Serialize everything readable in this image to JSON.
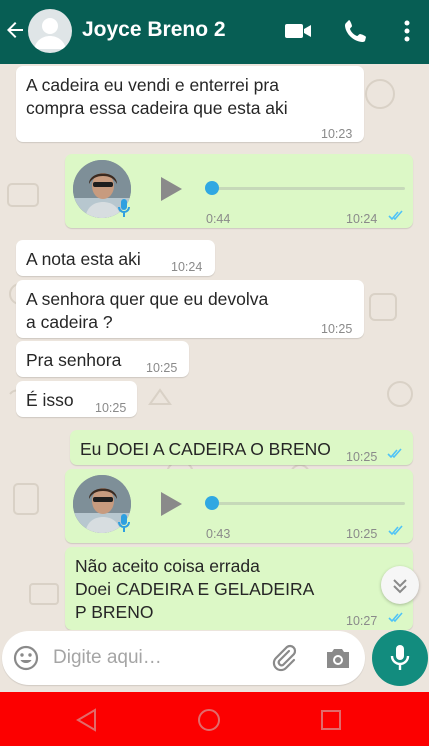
{
  "header": {
    "contact_name": "Joyce Breno 2",
    "icons": [
      "back-arrow-icon",
      "default-avatar-icon",
      "video-call-icon",
      "phone-call-icon",
      "more-vert-icon"
    ]
  },
  "messages": [
    {
      "type": "text",
      "direction": "incoming",
      "text": "A cadeira eu vendi e enterrei pra\ncompra essa cadeira que esta aki",
      "time": "10:23"
    },
    {
      "type": "voice",
      "direction": "outgoing",
      "duration": "0:44",
      "time": "10:24",
      "status": "read"
    },
    {
      "type": "text",
      "direction": "incoming",
      "text": "A nota esta aki",
      "time": "10:24"
    },
    {
      "type": "text",
      "direction": "incoming",
      "text": "A senhora quer que eu devolva\na cadeira ?",
      "time": "10:25"
    },
    {
      "type": "text",
      "direction": "incoming",
      "text": "Pra senhora",
      "time": "10:25"
    },
    {
      "type": "text",
      "direction": "incoming",
      "text": "É isso",
      "time": "10:25"
    },
    {
      "type": "text",
      "direction": "outgoing",
      "text": "Eu DOEI A CADEIRA O BRENO",
      "time": "10:25",
      "status": "read"
    },
    {
      "type": "voice",
      "direction": "outgoing",
      "duration": "0:43",
      "time": "10:25",
      "status": "read"
    },
    {
      "type": "text",
      "direction": "outgoing",
      "text": "Não aceito coisa errada\nDoei CADEIRA E GELADEIRA\nP BRENO",
      "time": "10:27",
      "status": "read"
    }
  ],
  "composer": {
    "placeholder": "Digite aqui…",
    "icons": [
      "emoji-icon",
      "attach-clip-icon",
      "camera-icon",
      "mic-icon"
    ]
  },
  "colors": {
    "header": "#075e54",
    "chat_background": "#ece5dd",
    "outgoing_bubble": "#dcf8c6",
    "incoming_bubble": "#ffffff",
    "read_ticks": "#4fc3f7",
    "mic_button": "#128c7e",
    "nav_bar": "#fc0000"
  },
  "navbar": {
    "icons": [
      "nav-back-icon",
      "nav-home-icon",
      "nav-recents-icon"
    ]
  }
}
